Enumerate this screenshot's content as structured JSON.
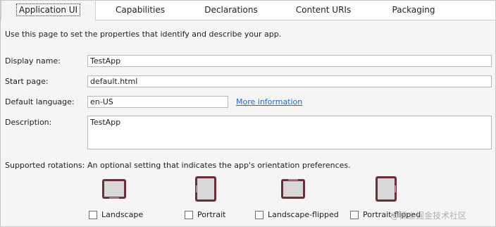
{
  "tabs": [
    {
      "label": "Application UI",
      "active": true
    },
    {
      "label": "Capabilities",
      "active": false
    },
    {
      "label": "Declarations",
      "active": false
    },
    {
      "label": "Content URIs",
      "active": false
    },
    {
      "label": "Packaging",
      "active": false
    }
  ],
  "intro": "Use this page to set the properties that identify and describe your app.",
  "fields": {
    "display_name": {
      "label": "Display name:",
      "value": "TestApp"
    },
    "start_page": {
      "label": "Start page:",
      "value": "default.html"
    },
    "default_language": {
      "label": "Default language:",
      "value": "en-US",
      "link": "More information"
    },
    "description": {
      "label": "Description:",
      "value": "TestApp"
    }
  },
  "rotations": {
    "label": "Supported rotations:",
    "description": "An optional setting that indicates the app's orientation preferences.",
    "options": [
      {
        "label": "Landscape",
        "icon": "landscape-icon",
        "checked": false
      },
      {
        "label": "Portrait",
        "icon": "portrait-icon",
        "checked": false
      },
      {
        "label": "Landscape-flipped",
        "icon": "landscape-flipped-icon",
        "checked": false
      },
      {
        "label": "Portrait-flipped",
        "icon": "portrait-flipped-icon",
        "checked": false
      }
    ]
  },
  "watermark": "@稀土掘金技术社区",
  "colors": {
    "link": "#1f6bb8",
    "device_frame": "#6b2f3a",
    "screen": "#d8d8d8"
  }
}
